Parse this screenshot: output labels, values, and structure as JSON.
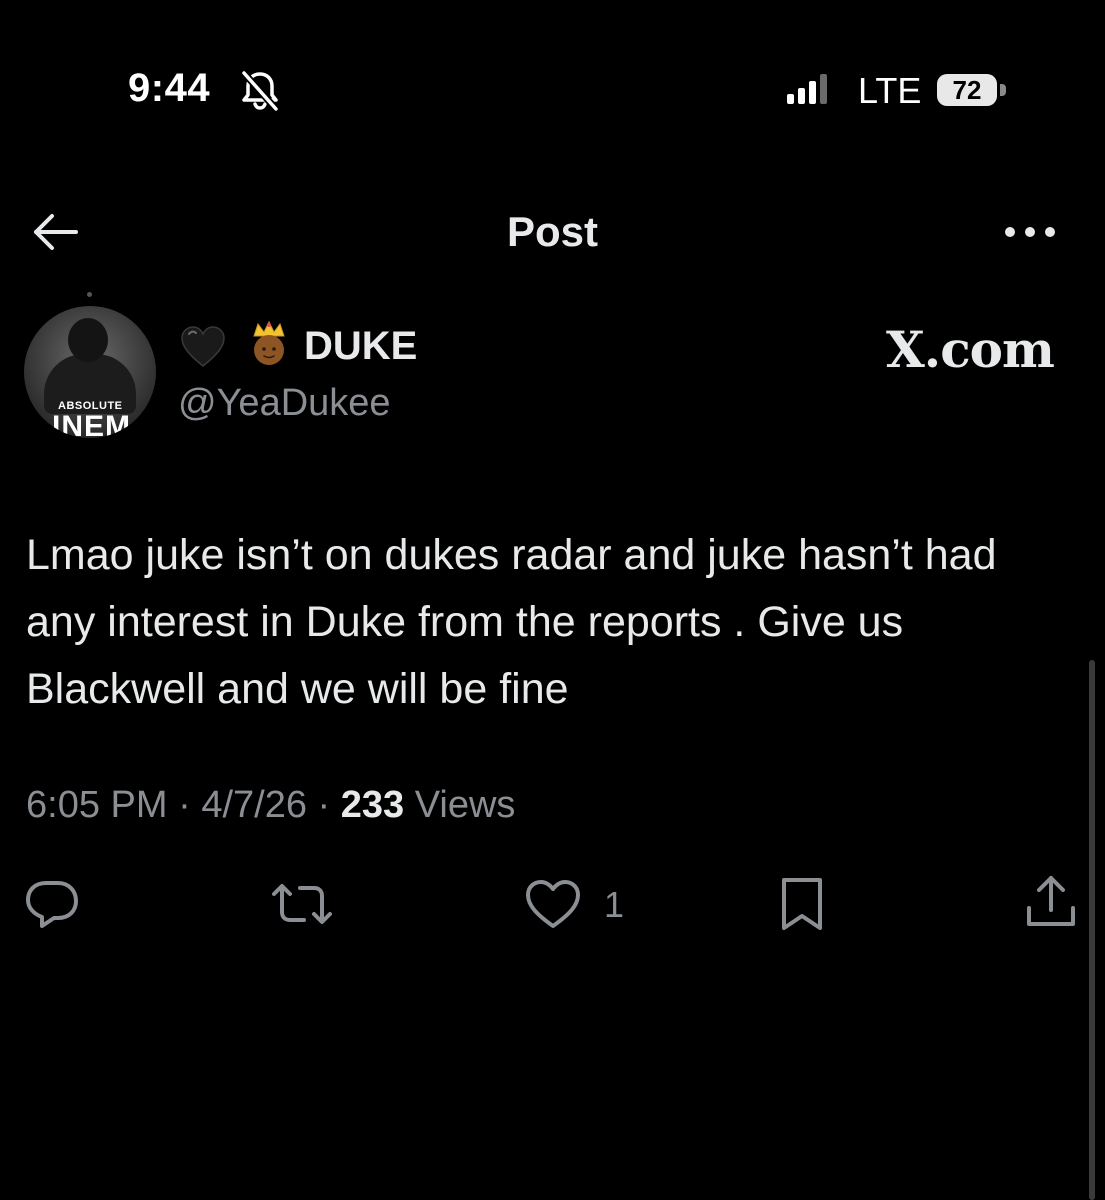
{
  "status_bar": {
    "time": "9:44",
    "network": "LTE",
    "battery": "72"
  },
  "header": {
    "title": "Post"
  },
  "author": {
    "avatar_text_small": "ABSOLUTE",
    "avatar_text_large": "INEM",
    "display_name": "DUKE",
    "handle": "@YeaDukee"
  },
  "watermark": "X.com",
  "post": {
    "text": "Lmao juke isn’t on dukes radar and juke hasn’t had any interest in Duke from the reports . Give us Blackwell and we will be fine",
    "time": "6:05 PM",
    "date": "4/7/26",
    "views_count": "233",
    "views_label": "Views"
  },
  "actions": {
    "like_count": "1"
  },
  "icons": {
    "status": [
      "bell-slash-icon",
      "signal-icon"
    ],
    "header": [
      "back-arrow-icon",
      "more-icon"
    ],
    "name": [
      "black-heart-icon",
      "crown-person-icon"
    ],
    "actions": [
      "reply-icon",
      "repost-icon",
      "like-icon",
      "bookmark-icon",
      "share-icon"
    ]
  },
  "colors": {
    "background": "#000000",
    "primary_text": "#e7e9ea",
    "secondary_text": "#8b8f94"
  }
}
